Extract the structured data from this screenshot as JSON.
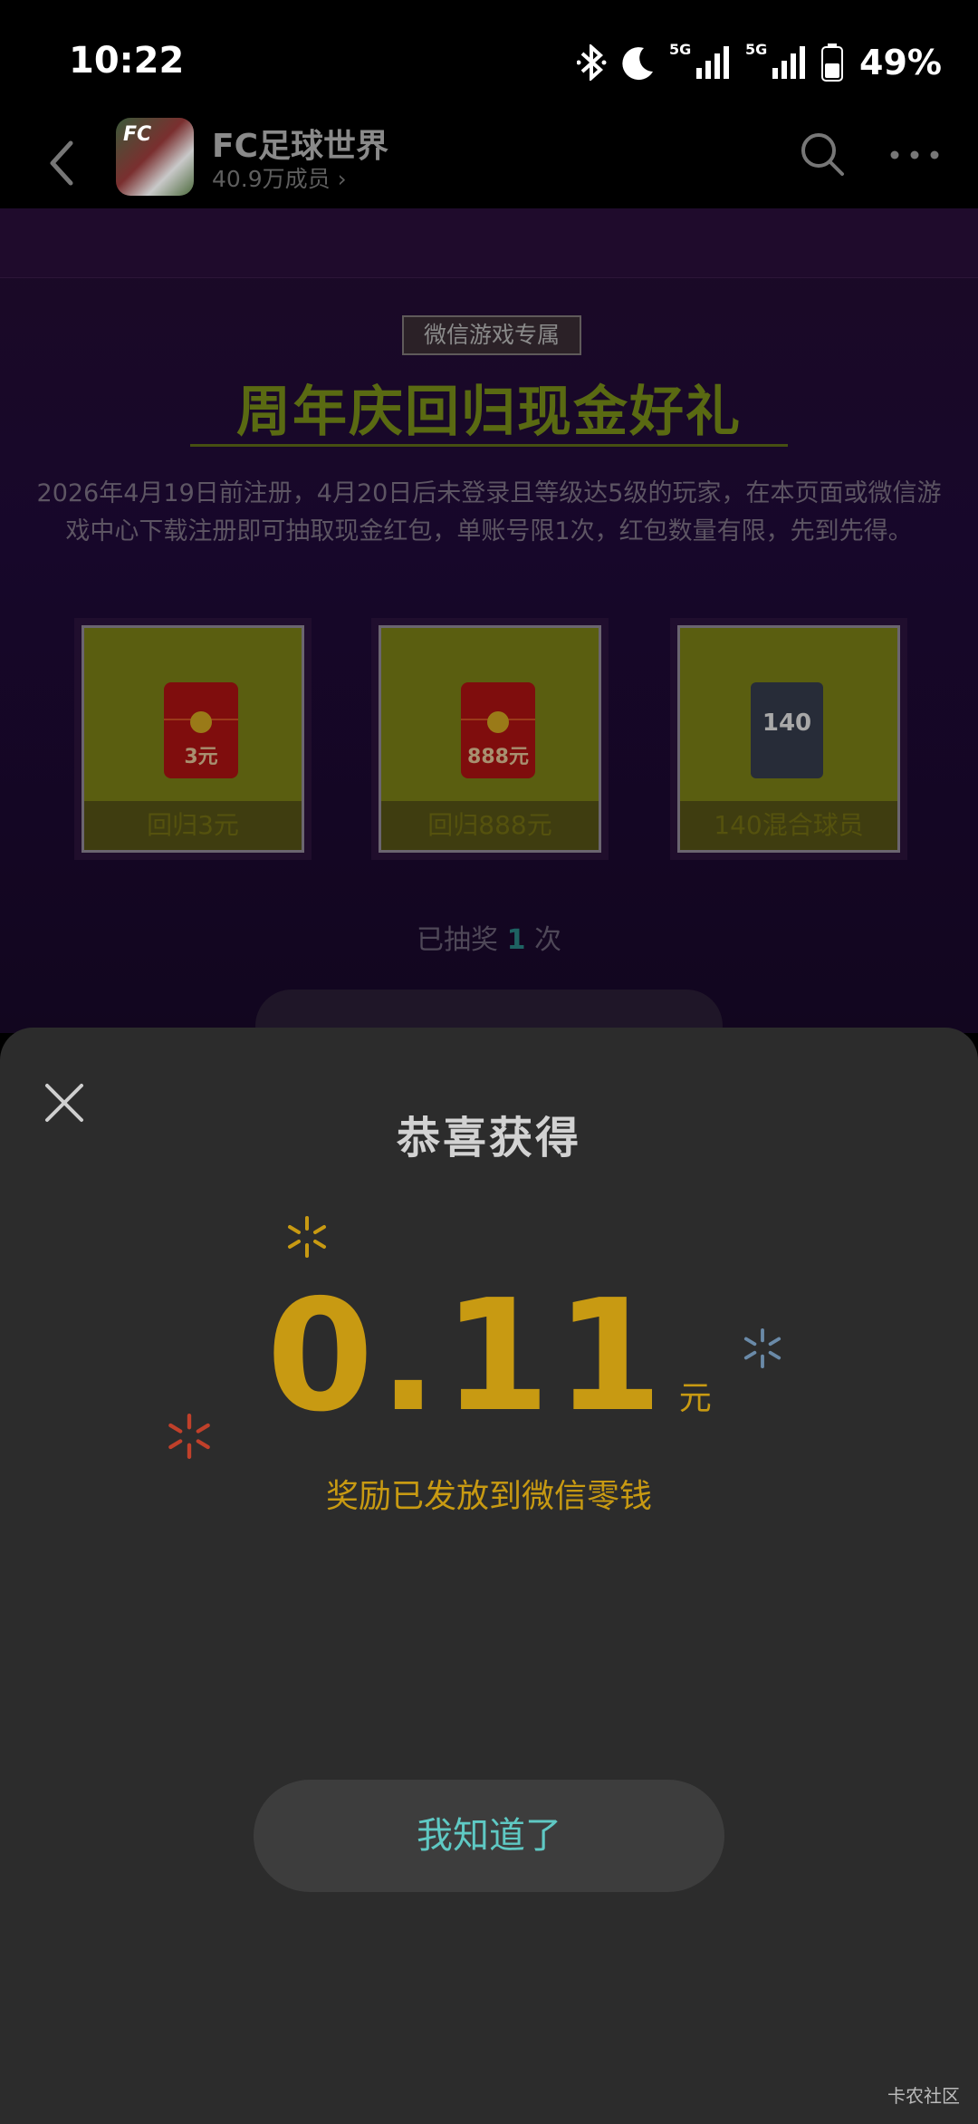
{
  "status_bar": {
    "time": "10:22",
    "battery": "49%",
    "network_1": "5G",
    "network_2": "5G"
  },
  "header": {
    "title": "FC足球世界",
    "members": "40.9万成员 ›",
    "icon_text": "FC"
  },
  "promo": {
    "tag": "微信游戏专属",
    "headline": "周年庆回归现金好礼",
    "description": "2026年4月19日前注册，4月20日后未登录且等级达5级的玩家，在本页面或微信游戏中心下载注册即可抽取现金红包，单账号限1次，红包数量有限，先到先得。",
    "prizes": [
      {
        "label": "回归3元",
        "badge": "3元"
      },
      {
        "label": "回归888元",
        "badge": "888元"
      },
      {
        "label": "140混合球员",
        "badge": "140"
      }
    ],
    "draw_prefix": "已抽奖 ",
    "draw_count": "1",
    "draw_suffix": " 次"
  },
  "dialog": {
    "title": "恭喜获得",
    "amount": "0.11",
    "unit": "元",
    "notice": "奖励已发放到微信零钱",
    "button": "我知道了"
  },
  "watermark": "卡农社区",
  "colors": {
    "gold": "#c89a12",
    "teal": "#5fc9c4",
    "sheet": "#2c2c2c"
  }
}
